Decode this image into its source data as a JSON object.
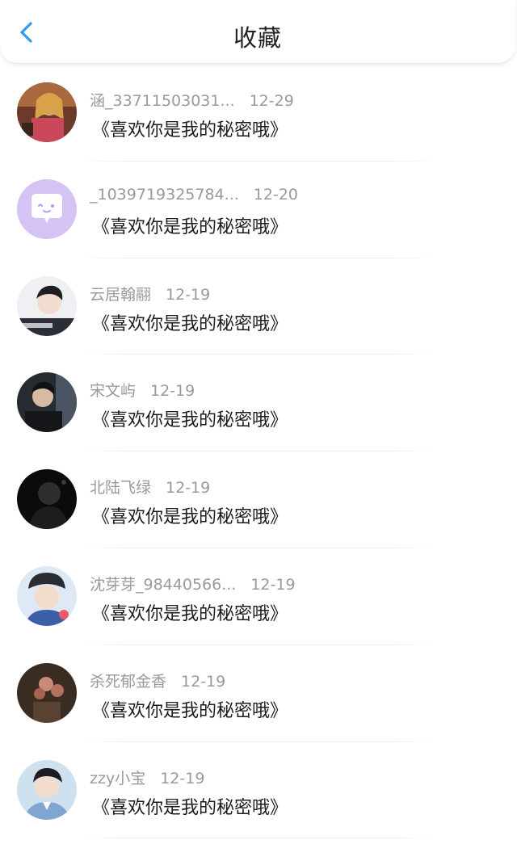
{
  "header": {
    "title": "收藏",
    "back_icon": "chevron-left-icon",
    "accent_color": "#2f9bea"
  },
  "items": [
    {
      "username": "涵_33711503031...",
      "date": "12-29",
      "content": "《喜欢你是我的秘密哦》",
      "avatar": "photo-avatar-girl"
    },
    {
      "username": "_1039719325784...",
      "date": "12-20",
      "content": "《喜欢你是我的秘密哦》",
      "avatar": "default-chat-bubble-avatar"
    },
    {
      "username": "云居翰翮",
      "date": "12-19",
      "content": "《喜欢你是我的秘密哦》",
      "avatar": "photo-avatar-boy"
    },
    {
      "username": "宋文屿",
      "date": "12-19",
      "content": "《喜欢你是我的秘密哦》",
      "avatar": "photo-avatar-dark"
    },
    {
      "username": "北陆飞绿",
      "date": "12-19",
      "content": "《喜欢你是我的秘密哦》",
      "avatar": "photo-avatar-silhouette"
    },
    {
      "username": "沈芽芽_98440566...",
      "date": "12-19",
      "content": "《喜欢你是我的秘密哦》",
      "avatar": "photo-avatar-boy-hat"
    },
    {
      "username": "杀死郁金香",
      "date": "12-19",
      "content": "《喜欢你是我的秘密哦》",
      "avatar": "photo-avatar-flowers"
    },
    {
      "username": "zzy小宝",
      "date": "12-19",
      "content": "《喜欢你是我的秘密哦》",
      "avatar": "photo-avatar-boy-blue"
    }
  ]
}
